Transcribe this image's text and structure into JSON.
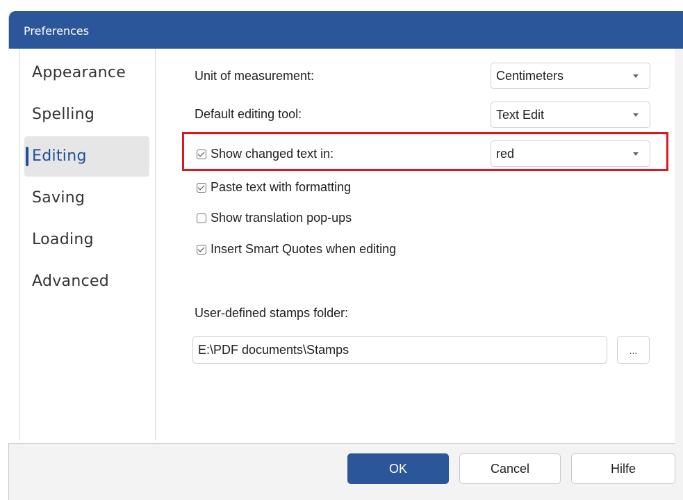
{
  "window": {
    "title": "Preferences"
  },
  "sidebar": {
    "items": [
      {
        "label": "Appearance"
      },
      {
        "label": "Spelling"
      },
      {
        "label": "Editing"
      },
      {
        "label": "Saving"
      },
      {
        "label": "Loading"
      },
      {
        "label": "Advanced"
      }
    ],
    "selected": "Editing"
  },
  "editing": {
    "unit_label": "Unit of measurement:",
    "unit_value": "Centimeters",
    "tool_label": "Default editing tool:",
    "tool_value": "Text Edit",
    "show_changed": {
      "label": "Show changed text in:",
      "checked": true,
      "value": "red"
    },
    "paste_formatting": {
      "label": "Paste text with formatting",
      "checked": true
    },
    "translation_popups": {
      "label": "Show translation pop-ups",
      "checked": false
    },
    "smart_quotes": {
      "label": "Insert Smart Quotes when editing",
      "checked": true
    },
    "stamps_label": "User-defined stamps folder:",
    "stamps_path": "E:\\PDF documents\\Stamps",
    "browse_label": "..."
  },
  "footer": {
    "ok_label": "OK",
    "cancel_label": "Cancel",
    "help_label": "Hilfe"
  },
  "colors": {
    "accent": "#2b579a",
    "highlight": "#e0161e"
  }
}
